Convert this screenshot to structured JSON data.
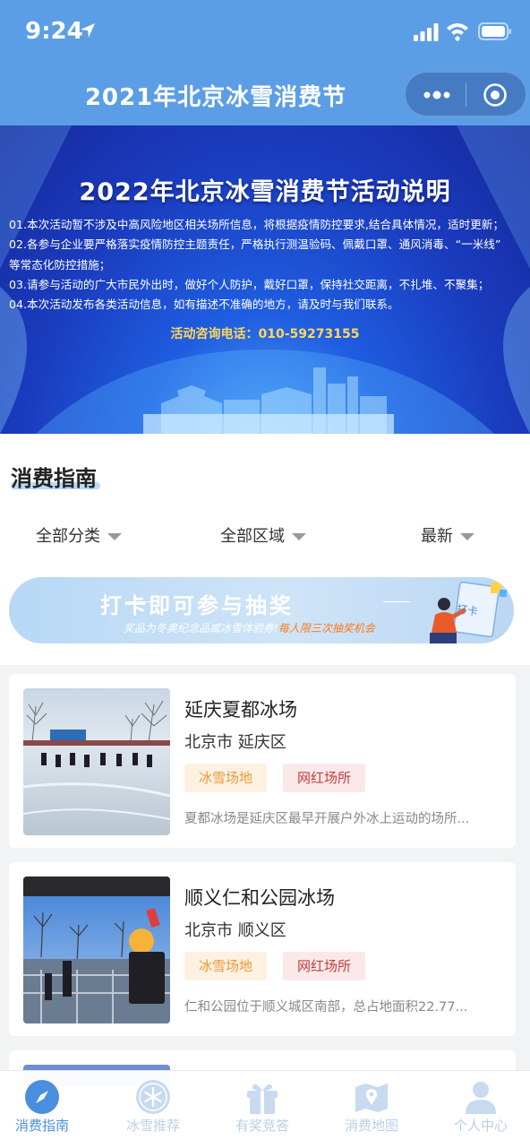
{
  "status_bar": {
    "time": "9:24"
  },
  "header": {
    "title": "2021年北京冰雪消费节"
  },
  "banner": {
    "title": "2022年北京冰雪消费节活动说明",
    "notes": [
      "01.本次活动暂不涉及中高风险地区相关场所信息，将根据疫情防控要求,结合具体情况，适时更新；",
      "02.各参与企业要严格落实疫情防控主题责任，严格执行测温验码、佩戴口罩、通风消毒、“一米线”",
      "    等常态化防控措施；",
      "03.请参与活动的广大市民外出时，做好个人防护，戴好口罩，保持社交距离，不扎堆、不聚集；",
      "04.本次活动发布各类活动信息，如有描述不准确的地方，请及时与我们联系。"
    ],
    "phone": "活动咨询电话：010-59273155"
  },
  "section": {
    "title": "消费指南"
  },
  "filters": [
    {
      "label": "全部分类"
    },
    {
      "label": "全部区域"
    },
    {
      "label": "最新"
    }
  ],
  "promo": {
    "main": "打卡即可参与抽奖",
    "sub": "奖品为冬奥纪念品或冰雪体验券!",
    "highlight": "每人限三次抽奖机会",
    "sign": "打卡"
  },
  "venues": [
    {
      "name": "延庆夏都冰场",
      "location": "北京市 延庆区",
      "tags": [
        "冰雪场地",
        "网红场所"
      ],
      "desc": "夏都冰场是延庆区最早开展户外冰上运动的场所..."
    },
    {
      "name": "顺义仁和公园冰场",
      "location": "北京市 顺义区",
      "tags": [
        "冰雪场地",
        "网红场所"
      ],
      "desc": "仁和公园位于顺义城区南部，总占地面积22.77..."
    }
  ],
  "tabs": [
    {
      "label": "消费指南",
      "icon": "compass-icon",
      "active": true
    },
    {
      "label": "冰雪推荐",
      "icon": "snowflake-icon",
      "active": false
    },
    {
      "label": "有奖竞答",
      "icon": "gift-icon",
      "active": false
    },
    {
      "label": "消费地图",
      "icon": "map-icon",
      "active": false
    },
    {
      "label": "个人中心",
      "icon": "user-icon",
      "active": false
    }
  ],
  "colors": {
    "header": "#5b9ee6",
    "accent": "#4a8fdf",
    "tag_orange": "#e99a34",
    "tag_red": "#c63b3b"
  }
}
